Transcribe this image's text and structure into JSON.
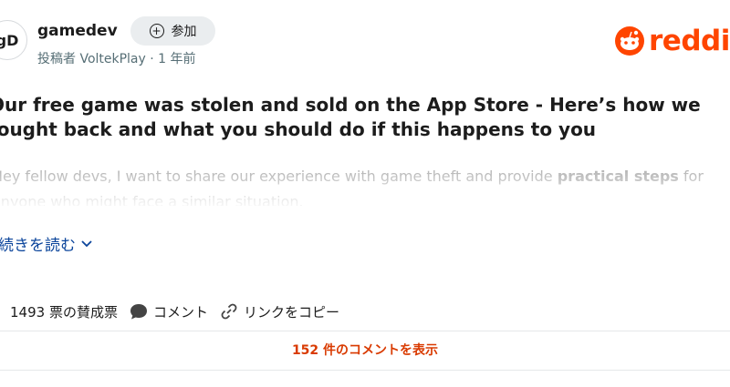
{
  "post": {
    "subreddit_avatar": "gD",
    "subreddit": "gamedev",
    "join_label": "参加",
    "meta": "投稿者 VoltekPlay · 1 年前",
    "title": "Our free game was stolen and sold on the App Store - Here’s how we fought back and what you should do if this happens to you",
    "body_prefix": "Hey fellow devs, I want to share our experience with game theft and provide ",
    "body_bold": "practical steps",
    "body_suffix": " for anyone who might face a similar situation.",
    "read_more": "続きを読む",
    "votes": "1493 票の賛成票",
    "comments_label": "コメント",
    "copy_link": "リンクをコピー",
    "view_comments": "152 件のコメントを表示"
  },
  "brand": {
    "logo_text": "reddit",
    "accent": "#ff4500",
    "link_color": "#0a449b",
    "comment_link_color": "#d93a00"
  }
}
